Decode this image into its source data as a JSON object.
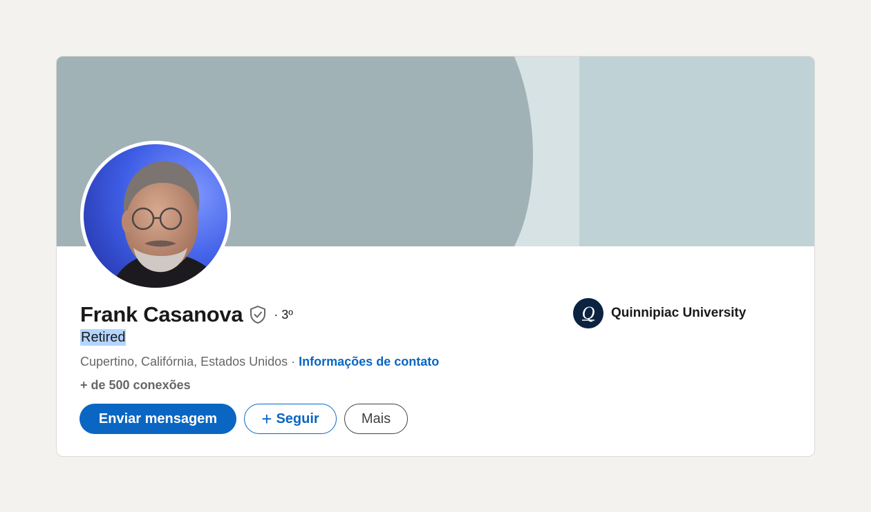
{
  "profile": {
    "name": "Frank Casanova",
    "degree": "· 3º",
    "headline": "Retired",
    "location": "Cupertino, Califórnia, Estados Unidos",
    "separator": " · ",
    "contact_link": "Informações de contato",
    "connections": "+ de 500 conexões"
  },
  "actions": {
    "message_label": "Enviar mensagem",
    "follow_label": "Seguir",
    "more_label": "Mais"
  },
  "education": {
    "org_name": "Quinnipiac University",
    "logo_letter": "Q"
  },
  "icons": {
    "verify": "shield-check-icon",
    "follow": "plus-icon",
    "org_logo": "quinnipiac-logo-icon"
  },
  "colors": {
    "primary": "#0a66c2",
    "banner_dark": "#a0b2b5",
    "banner_light": "#bfd3d7",
    "highlight": "#b4d5fe",
    "org_logo_bg": "#0b2240"
  }
}
